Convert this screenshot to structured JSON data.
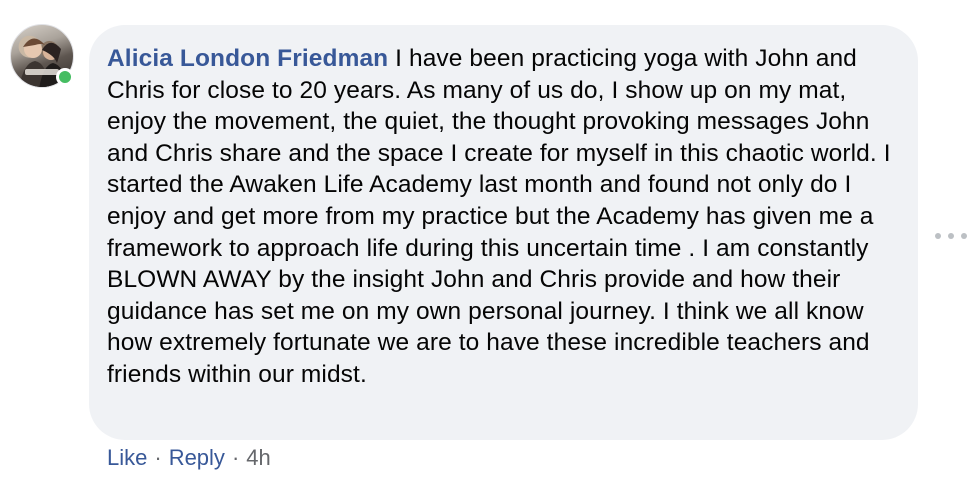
{
  "comment": {
    "author": "Alicia London Friedman",
    "text": "I have been practicing yoga with John and Chris for close to 20 years. As many of us do, I show up on my mat, enjoy the movement, the quiet, the thought provoking messages John and Chris share and the space I create for myself in this chaotic world. I started the Awaken Life Academy last month and found not only do I enjoy and get more from my practice but the Academy has given me a framework to approach life during this uncertain time . I am constantly BLOWN AWAY by the insight John and Chris provide and how their guidance has set me on my own personal journey. I think we all know how extremely fortunate we are to have these incredible teachers and friends within our midst.",
    "online_status": "online",
    "presence_color": "#45bd62"
  },
  "actions": {
    "like_label": "Like",
    "reply_label": "Reply",
    "separator": "·",
    "timestamp": "4h"
  },
  "more_options": {
    "icon": "more-horizontal-icon"
  },
  "colors": {
    "bubble_bg": "#f0f2f5",
    "link": "#385898",
    "text": "#050505",
    "meta": "#65676b"
  }
}
